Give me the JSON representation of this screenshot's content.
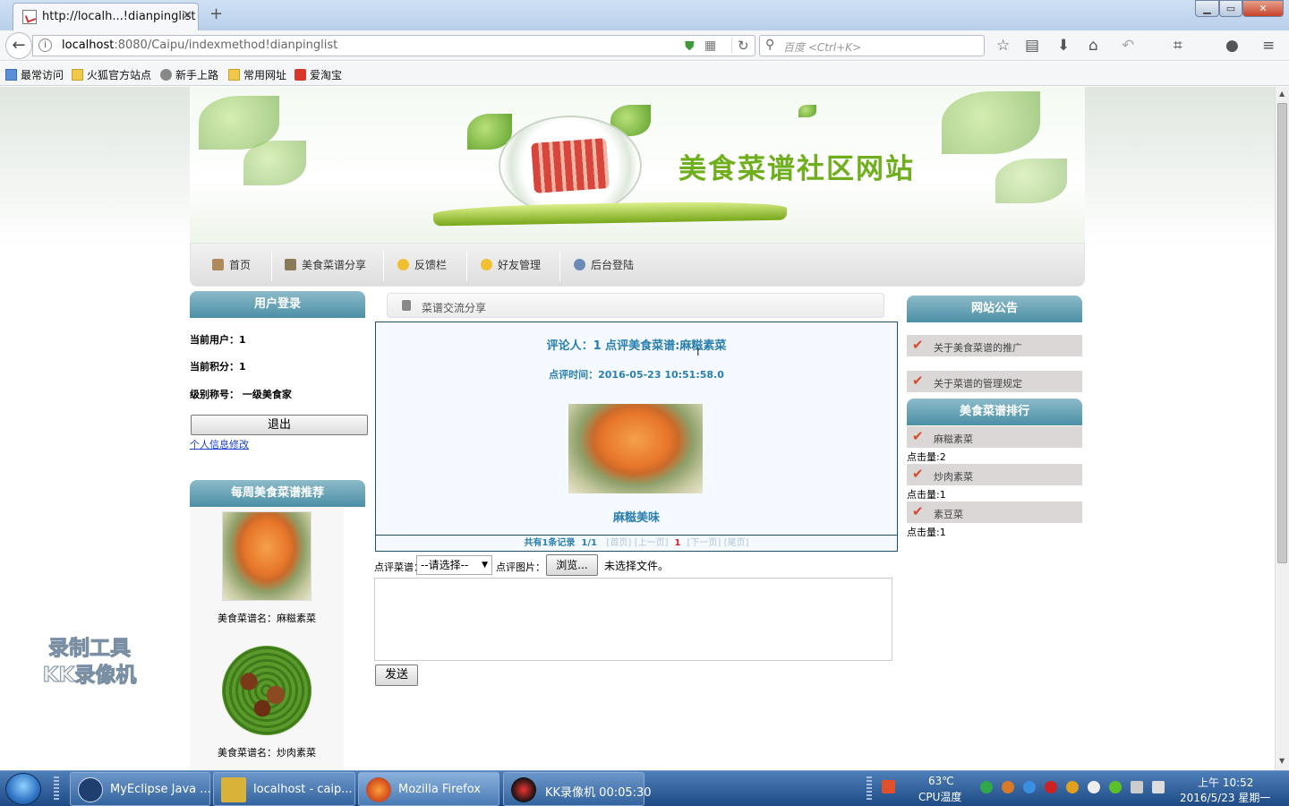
{
  "browser": {
    "tab_title": "http://localh...!dianpinglist",
    "new_tab": "+",
    "url_host": "localhost",
    "url_rest": ":8080/Caipu/indexmethod!dianpinglist",
    "search_placeholder": "百度 <Ctrl+K>",
    "win_min": "▁",
    "win_max": "▭",
    "win_close": "✕",
    "bookmarks": [
      "最常访问",
      "火狐官方站点",
      "新手上路",
      "常用网址",
      "爱淘宝"
    ]
  },
  "site": {
    "title": "美食菜谱社区网站",
    "menu": [
      "首页",
      "美食菜谱分享",
      "反馈栏",
      "好友管理",
      "后台登陆"
    ]
  },
  "left": {
    "login_header": "用户登录",
    "current_user": "当前用户：1",
    "current_points": "当前积分：1",
    "level": "级别称号：  一级美食家",
    "logout": "退出",
    "edit_profile": "个人信息修改",
    "weekly_header": "每周美食菜谱推荐",
    "recommend": [
      {
        "name": "美食菜谱名：麻糍素菜"
      },
      {
        "name": "美食菜谱名：炒肉素菜"
      }
    ]
  },
  "center": {
    "breadcrumb": "菜谱交流分享",
    "review_head": "评论人：1    点评美食菜谱:麻糍素菜",
    "review_time": "点评时间：2016-05-23 10:51:58.0",
    "dish_name": "麻糍美味",
    "pager": {
      "summary": "共有1条记录",
      "pages": "1/1",
      "first": "[首页]",
      "prev": "[上一页]",
      "current": "1",
      "next": "[下一页]",
      "last": "[尾页]"
    },
    "form": {
      "recipe_label": "点评菜谱：",
      "select_value": "--请选择--",
      "image_label": "点评图片：",
      "browse": "浏览...",
      "no_file": "未选择文件。",
      "send": "发送"
    }
  },
  "right": {
    "notice_header": "网站公告",
    "notices": [
      "关于美食菜谱的推广",
      "关于菜谱的管理规定"
    ],
    "rank_header": "美食菜谱排行",
    "rank": [
      {
        "name": "麻糍素菜",
        "clicks": "点击量:2"
      },
      {
        "name": "炒肉素菜",
        "clicks": "点击量:1"
      },
      {
        "name": "素豆菜",
        "clicks": "点击量:1"
      }
    ]
  },
  "watermark": [
    "录制工具",
    "KK录像机"
  ],
  "taskbar": {
    "tasks": [
      "MyEclipse Java ...",
      "localhost - caip...",
      "Mozilla Firefox",
      "KK录像机 00:05:30"
    ],
    "cpu_temp": "63℃",
    "cpu_label": "CPU温度",
    "time": "上午 10:52",
    "date": "2016/5/23 星期一"
  }
}
